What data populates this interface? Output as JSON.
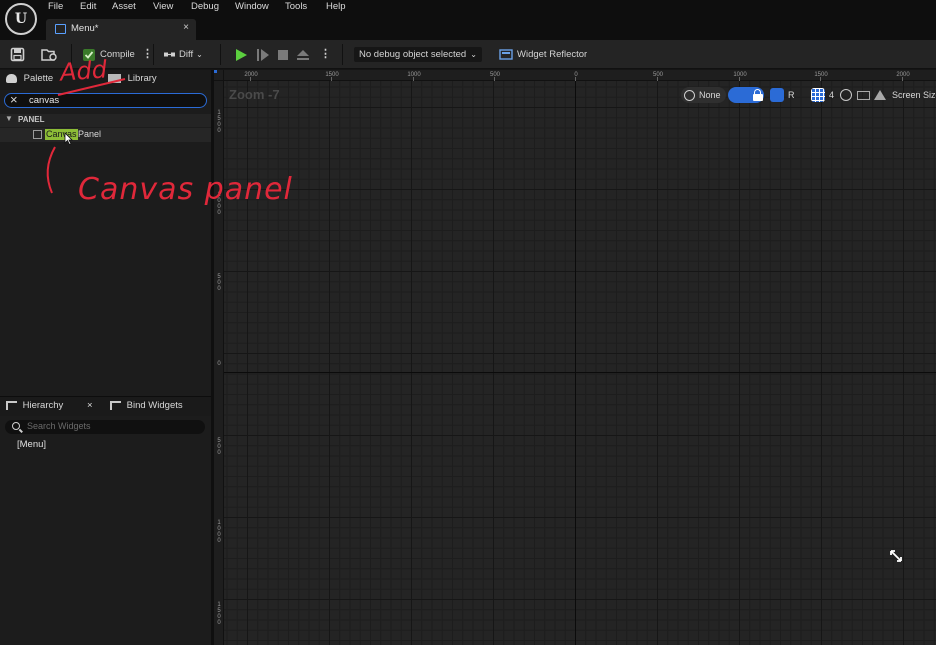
{
  "app": {
    "logo": "unreal-engine-logo",
    "menu": [
      "File",
      "Edit",
      "Asset",
      "View",
      "Debug",
      "Window",
      "Tools",
      "Help"
    ],
    "tab": {
      "label": "Menu*",
      "close": "×"
    }
  },
  "toolbar": {
    "compile_label": "Compile",
    "diff_label": "Diff",
    "debug_object": "No debug object selected",
    "widget_reflector": "Widget Reflector"
  },
  "palette": {
    "tab_palette": "Palette",
    "tab_library": "Library",
    "search_value": "canvas",
    "category": "PANEL",
    "item_highlight": "Canvas",
    "item_rest": "Panel"
  },
  "hierarchy": {
    "tab_hierarchy": "Hierarchy",
    "tab_close": "×",
    "tab_bind": "Bind Widgets",
    "search_placeholder": "Search Widgets",
    "root": "[Menu]"
  },
  "designer": {
    "zoom": "Zoom -7",
    "none_label": "None",
    "r_label": "R",
    "grid_snap": "4",
    "screen_size": "Screen Size",
    "ruler_top": [
      "2000",
      "1500",
      "1000",
      "500",
      "0",
      "500",
      "1000",
      "1500",
      "2000"
    ],
    "ruler_left": [
      "1500",
      "1000",
      "500",
      "0",
      "500",
      "1000",
      "1500"
    ]
  },
  "annotations": {
    "add": "Add",
    "canvas_panel": "Canvas panel"
  },
  "colors": {
    "accent_blue": "#2b6bd6",
    "highlight_green": "#8dbd37",
    "play_green": "#5ccf3f",
    "annotation_red": "#e0283a"
  }
}
